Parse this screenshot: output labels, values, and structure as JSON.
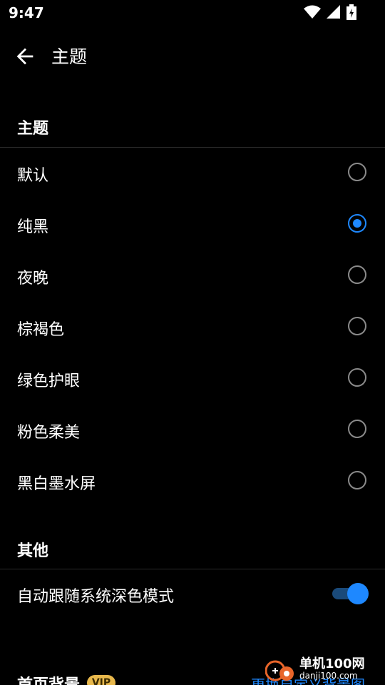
{
  "status_bar": {
    "time": "9:47"
  },
  "app_bar": {
    "title": "主题"
  },
  "sections": {
    "theme_header": "主题",
    "theme_options": [
      {
        "label": "默认",
        "selected": false
      },
      {
        "label": "纯黑",
        "selected": true
      },
      {
        "label": "夜晚",
        "selected": false
      },
      {
        "label": "棕褐色",
        "selected": false
      },
      {
        "label": "绿色护眼",
        "selected": false
      },
      {
        "label": "粉色柔美",
        "selected": false
      },
      {
        "label": "黑白墨水屏",
        "selected": false
      }
    ],
    "other_header": "其他",
    "auto_dark": {
      "label": "自动跟随系统深色模式",
      "enabled": true
    },
    "homepage_bg": {
      "label": "首页背景",
      "badge": "VIP",
      "link": "更换自定义背景图"
    }
  },
  "watermark": {
    "name": "单机100网",
    "url": "danji100.com"
  },
  "colors": {
    "accent": "#1e88ff",
    "background": "#000000",
    "vip": "#e8b84c"
  }
}
